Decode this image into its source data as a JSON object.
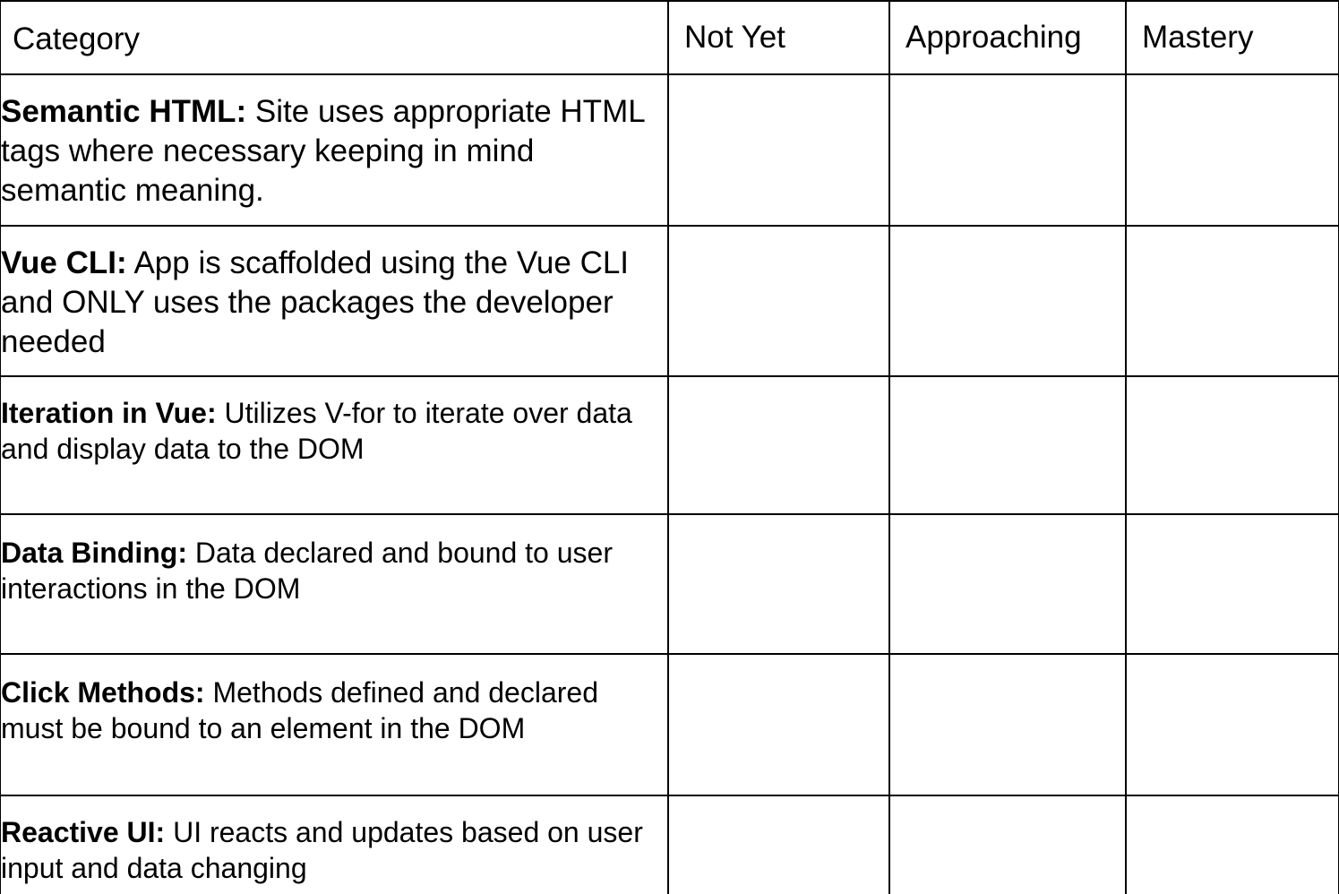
{
  "rubric": {
    "headers": {
      "category": "Category",
      "levels": [
        "Not Yet",
        "Approaching",
        "Mastery"
      ]
    },
    "rows": [
      {
        "name": "Semantic HTML:",
        "description": " Site uses appropriate HTML tags where necessary keeping in mind semantic meaning."
      },
      {
        "name": "Vue CLI:",
        "description": " App is scaffolded using the Vue CLI and ONLY uses the packages the developer needed"
      },
      {
        "name": "Iteration in Vue:",
        "description": " Utilizes V-for to iterate over data and display data to the DOM"
      },
      {
        "name": "Data Binding:",
        "description": " Data declared and bound to user interactions in the DOM"
      },
      {
        "name": "Click Methods:",
        "description": " Methods defined and declared must be bound to an element in the DOM"
      },
      {
        "name": "Reactive UI:",
        "description": " UI reacts and updates based on user input and data changing"
      }
    ]
  }
}
